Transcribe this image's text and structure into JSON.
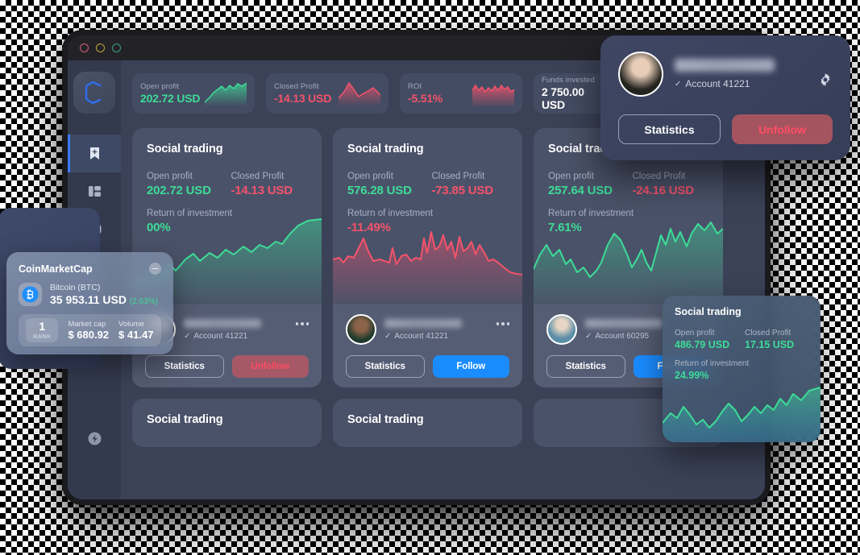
{
  "window": {
    "traffic_lights": [
      "close",
      "minimize",
      "maximize"
    ]
  },
  "sidebar": {
    "logo": "coin-logo",
    "items": [
      {
        "name": "bookmark-add-icon",
        "label": "Watchlist",
        "active": true
      },
      {
        "name": "dashboard-icon",
        "label": "Dashboard",
        "active": false
      },
      {
        "name": "terminal-icon",
        "label": "Terminal",
        "active": false
      }
    ],
    "bottom_item": {
      "name": "lightning-icon",
      "label": "Activity"
    }
  },
  "kpis": [
    {
      "label": "Open profit",
      "value": "202.72 USD",
      "tone": "pos",
      "spark": "up-green"
    },
    {
      "label": "Closed Profit",
      "value": "-14.13 USD",
      "tone": "neg",
      "spark": "peak-red"
    },
    {
      "label": "ROI",
      "value": "-5.51%",
      "tone": "neg",
      "spark": "volatile-red"
    },
    {
      "label": "Funds invested",
      "value": "2 750.00 USD",
      "tone": "neutral",
      "spark": "grey-mountain"
    }
  ],
  "cards": [
    {
      "title": "Social trading",
      "open_profit_label": "Open profit",
      "open_profit": "202.72 USD",
      "closed_profit_label": "Closed Profit",
      "closed_profit": "-14.13 USD",
      "closed_tone": "neg",
      "roi_label": "Return of investment",
      "roi": "00%",
      "roi_tone": "pos",
      "chart": "green-uptrend",
      "account": "Account 41221",
      "primary_button": "Statistics",
      "secondary_button": "Unfollow",
      "secondary_style": "unfollow"
    },
    {
      "title": "Social trading",
      "open_profit_label": "Open profit",
      "open_profit": "576.28 USD",
      "closed_profit_label": "Closed Profit",
      "closed_profit": "-73.85  USD",
      "closed_tone": "neg",
      "roi_label": "Return of investment",
      "roi": "-11.49%",
      "roi_tone": "neg",
      "chart": "red-volatile",
      "account": "Account 41221",
      "primary_button": "Statistics",
      "secondary_button": "Follow",
      "secondary_style": "follow"
    },
    {
      "title": "Social trading",
      "open_profit_label": "Open profit",
      "open_profit": "257.64 USD",
      "closed_profit_label": "Closed Profit",
      "closed_profit": "-24.16 USD",
      "closed_tone": "neg",
      "roi_label": "Return of investment",
      "roi": "7.61%",
      "roi_tone": "pos",
      "chart": "green-wave",
      "account": "Account 60295",
      "primary_button": "Statistics",
      "secondary_button": "Follow",
      "secondary_style": "follow"
    }
  ],
  "bottom_cards": [
    {
      "title": "Social trading"
    },
    {
      "title": "Social trading"
    },
    {
      "title": ""
    }
  ],
  "profile_popup": {
    "name_redacted": true,
    "account": "Account 41221",
    "statistics_button": "Statistics",
    "unfollow_button": "Unfollow",
    "settings_icon": "gear-icon"
  },
  "coinmarketcap": {
    "title": "CoinMarketCap",
    "coin_name": "Bitcoin (BTC)",
    "price": "35 953.11 USD",
    "change": "(2.63%)",
    "rank_value": "1",
    "rank_label": "RANK",
    "market_cap_label": "Market cap",
    "market_cap": "$ 680.92",
    "volume_label": "Volume",
    "volume": "$ 41.47"
  },
  "floating_card": {
    "title": "Social trading",
    "open_profit_label": "Open profit",
    "open_profit": "486.79 USD",
    "closed_profit_label": "Closed Profit",
    "closed_profit": "17.15 USD",
    "roi_label": "Return of investment",
    "roi": "24.99%"
  },
  "colors": {
    "positive": "#3ddc97",
    "negative": "#f4536b",
    "follow_blue": "#1a8cff",
    "accent_blue": "#3d7cf4",
    "card_bg": "#4a5269",
    "app_bg": "#3b4257"
  }
}
